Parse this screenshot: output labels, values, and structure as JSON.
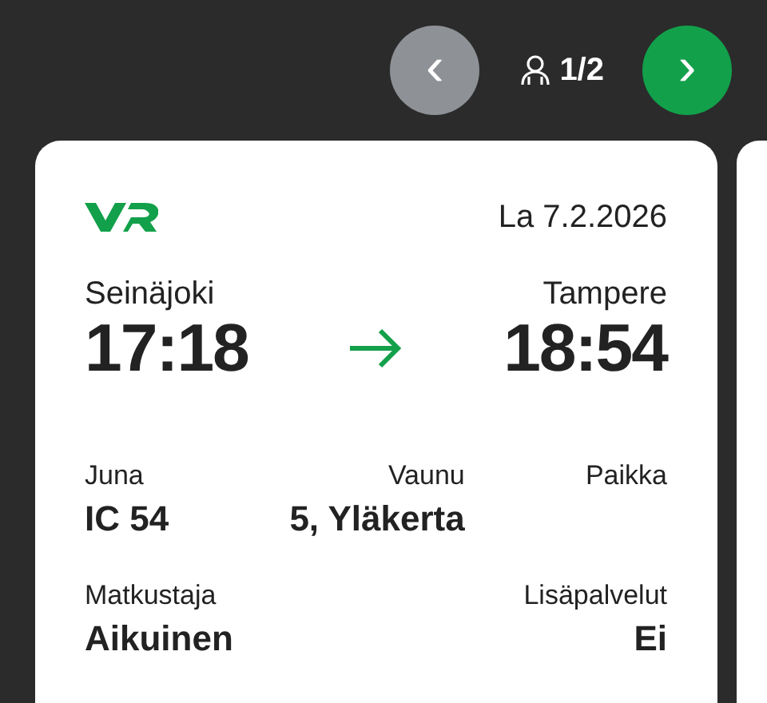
{
  "pager": {
    "prev": {
      "label": "‹",
      "disabled": true
    },
    "counter": "1/2",
    "next": {
      "label": "›",
      "disabled": false
    }
  },
  "ticket": {
    "date": "La 7.2.2026",
    "departure": {
      "station": "Seinäjoki",
      "time": "17:18"
    },
    "arrival": {
      "station": "Tampere",
      "time": "18:54"
    },
    "details_row_1": [
      {
        "label": "Juna",
        "value": "IC 54"
      },
      {
        "label": "Vaunu",
        "value": "5, Yläkerta"
      },
      {
        "label": "Paikka"
      }
    ],
    "details_row_2": [
      {
        "label": "Matkustaja",
        "value": "Aikuinen"
      },
      {
        "label": "Lisäpalvelut",
        "value": "Ei"
      }
    ]
  }
}
